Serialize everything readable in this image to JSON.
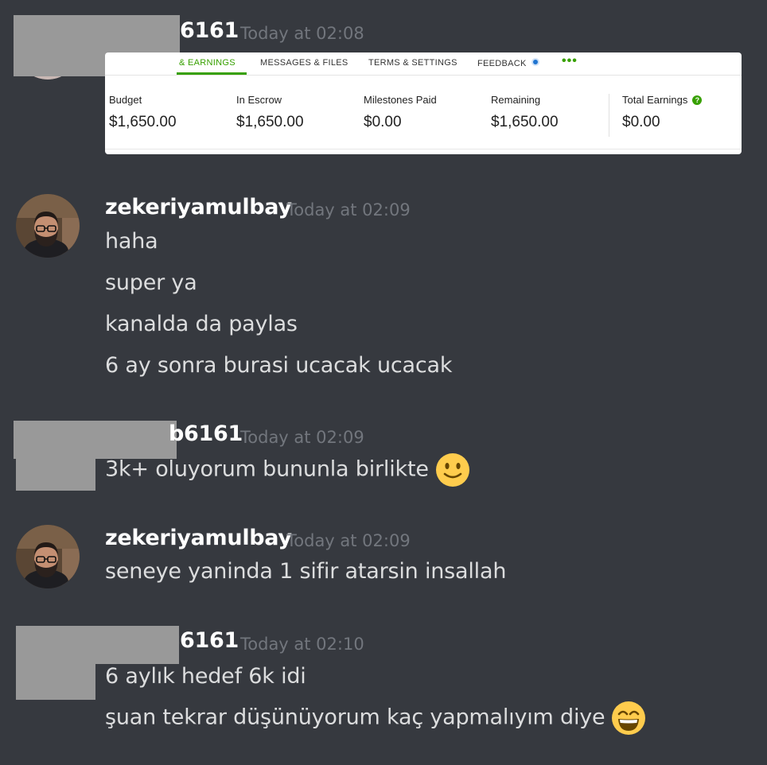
{
  "messages": [
    {
      "username_suffix": "6161",
      "timestamp": "Today at 02:08"
    },
    {
      "username": "zekeriyamulbay",
      "timestamp": "Today at 02:09",
      "lines": [
        "haha",
        "super ya",
        "kanalda da paylas",
        "6 ay sonra burasi ucacak ucacak"
      ]
    },
    {
      "username_suffix": "b6161",
      "timestamp": "Today at 02:09",
      "lines": [
        "3k+ oluyorum bununla birlikte"
      ],
      "emoji": "slightly-smiling-face"
    },
    {
      "username": "zekeriyamulbay",
      "timestamp": "Today at 02:09",
      "lines": [
        "seneye yaninda 1 sifir atarsin insallah"
      ]
    },
    {
      "username_suffix": "6161",
      "timestamp": "Today at 02:10",
      "lines": [
        "6 aylık hedef 6k idi",
        "şuan tekrar düşünüyorum kaç yapmalıyım diye"
      ],
      "emoji": "grinning-face-with-smiling-eyes"
    }
  ],
  "embed": {
    "tabs": [
      "& EARNINGS",
      "MESSAGES & FILES",
      "TERMS & SETTINGS",
      "FEEDBACK"
    ],
    "stats": [
      {
        "label": "Budget",
        "value": "$1,650.00"
      },
      {
        "label": "In Escrow",
        "value": "$1,650.00"
      },
      {
        "label": "Milestones Paid",
        "value": "$0.00"
      },
      {
        "label": "Remaining",
        "value": "$1,650.00"
      },
      {
        "label": "Total Earnings",
        "value": "$0.00"
      }
    ],
    "help_glyph": "?",
    "more_glyph": "•••",
    "accent_color": "#37a000"
  },
  "colors": {
    "background": "#36393f",
    "username": "#ffffff",
    "timestamp": "#72767d",
    "text": "#dcddde"
  }
}
